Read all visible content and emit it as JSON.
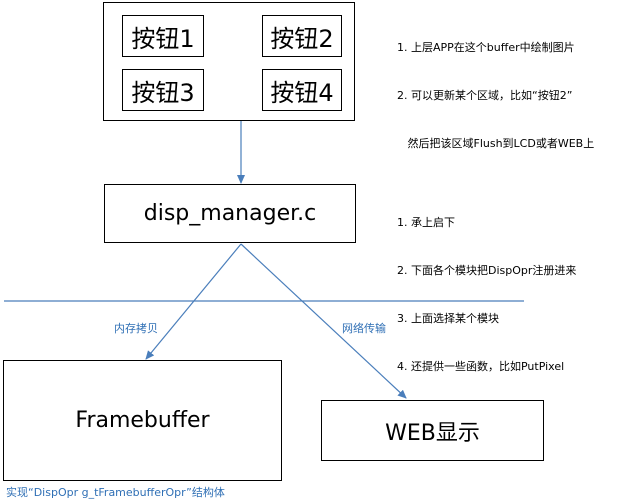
{
  "buttons": [
    "按钮1",
    "按钮2",
    "按钮3",
    "按钮4"
  ],
  "top_notes": [
    "1. 上层APP在这个buffer中绘制图片",
    "2. 可以更新某个区域，比如“按钮2”",
    "   然后把该区域Flush到LCD或者WEB上"
  ],
  "disp_manager_label": "disp_manager.c",
  "disp_notes": [
    "1. 承上启下",
    "2. 下面各个模块把DispOpr注册进来",
    "3. 上面选择某个模块",
    "4. 还提供一些函数，比如PutPixel"
  ],
  "edge_left_label": "内存拷贝",
  "edge_right_label": "网络传输",
  "framebuffer_label": "Framebuffer",
  "web_label": "WEB显示",
  "framebuffer_caption": "实现“DispOpr g_tFramebufferOpr”结构体",
  "colors": {
    "line": "#4a7ebb",
    "text": "#000000",
    "caption": "#2f6fb5"
  }
}
